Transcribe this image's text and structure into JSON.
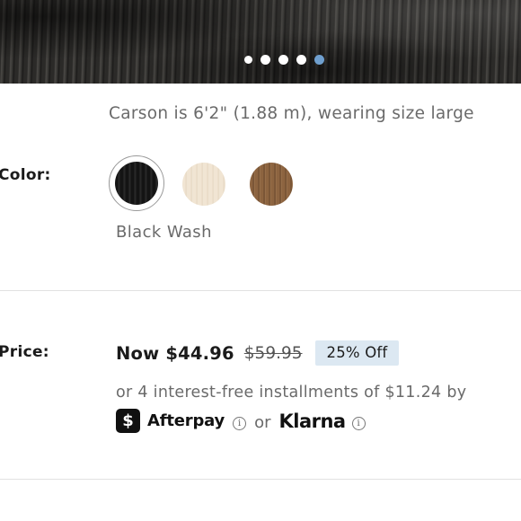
{
  "gallery": {
    "dot_count": 5,
    "active_index": 4,
    "active_color": "#6f9fce"
  },
  "product": {
    "model_note": "Carson is 6'2\" (1.88 m), wearing size large"
  },
  "color": {
    "label": "Color:",
    "selected_name": "Black Wash",
    "swatches": [
      {
        "name": "Black Wash",
        "hex": "#141414",
        "selected": true
      },
      {
        "name": "cream",
        "hex": "#f1e5d3",
        "selected": false
      },
      {
        "name": "brown",
        "hex": "#8d6440",
        "selected": false
      }
    ]
  },
  "price": {
    "label": "Price:",
    "now": "Now $44.96",
    "original": "$59.95",
    "discount": "25% Off",
    "installments": "or 4 interest-free installments of $11.24 by",
    "afterpay_glyph": "$",
    "afterpay": "Afterpay",
    "or": "or",
    "klarna": "Klarna",
    "info_glyph": "i"
  }
}
